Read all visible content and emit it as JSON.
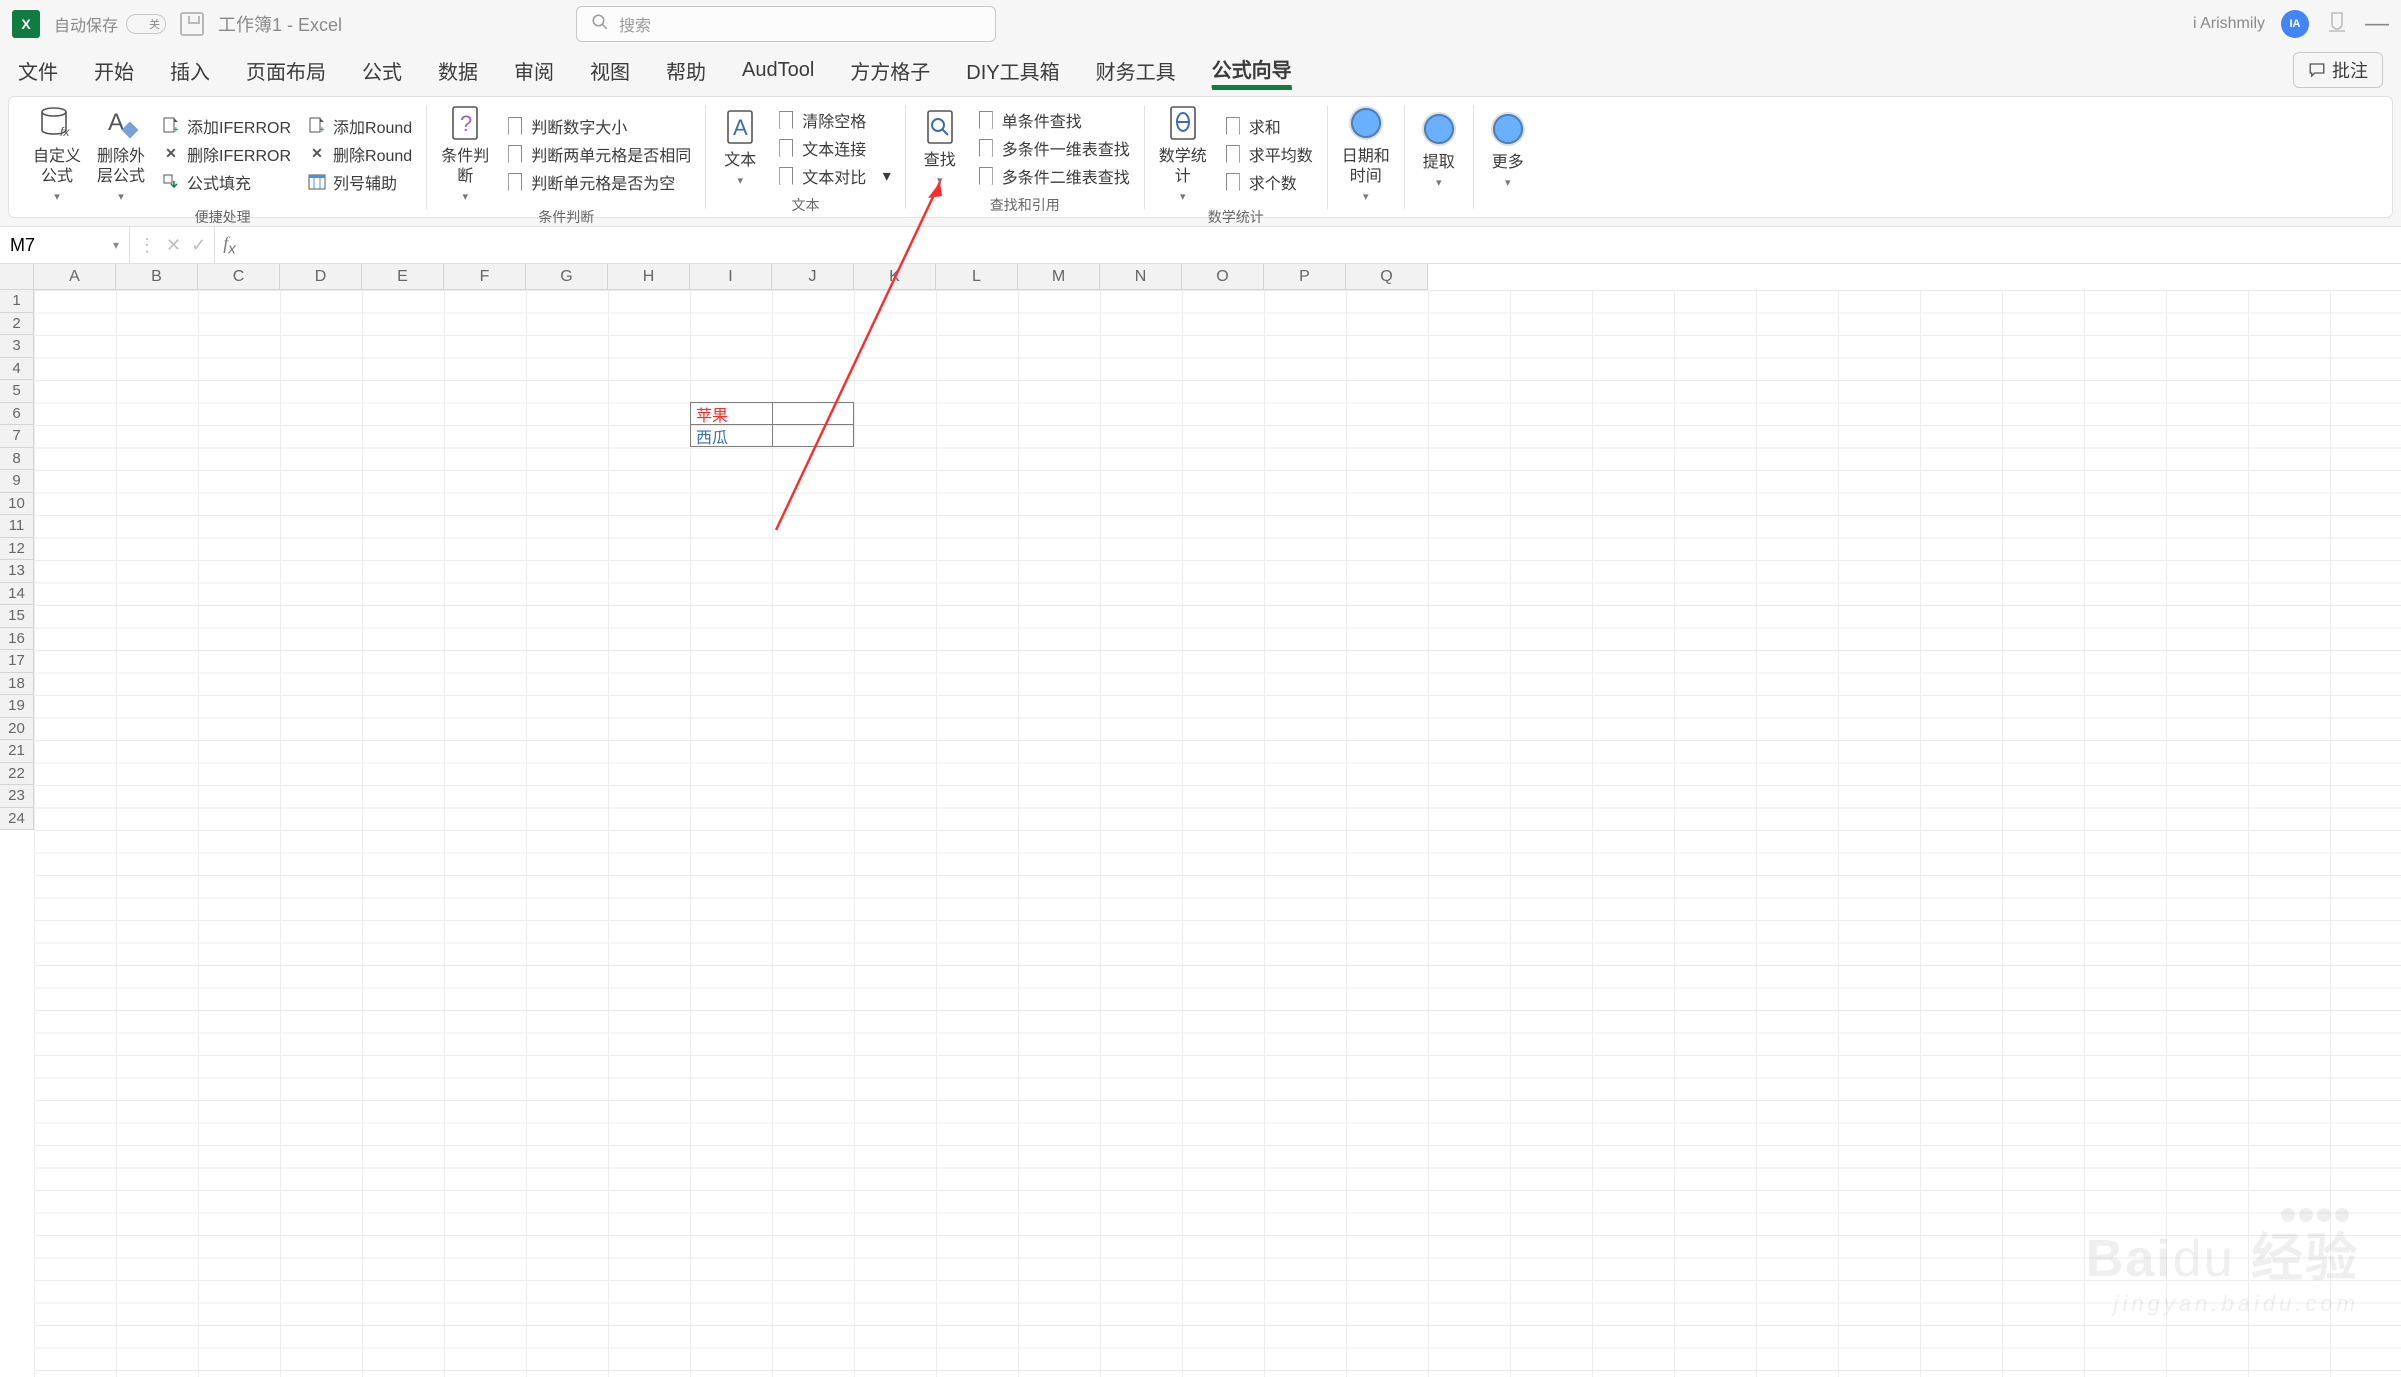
{
  "titleBar": {
    "appIconText": "X",
    "autosave": "自动保存",
    "autosaveState": "关",
    "docTitle": "工作簿1  -  Excel",
    "searchPlaceholder": "搜索",
    "user": "i Arishmily",
    "avatarInitials": "IA"
  },
  "tabs": {
    "items": [
      "文件",
      "开始",
      "插入",
      "页面布局",
      "公式",
      "数据",
      "审阅",
      "视图",
      "帮助",
      "AudTool",
      "方方格子",
      "DIY工具箱",
      "财务工具",
      "公式向导"
    ],
    "activeIndex": 13,
    "commentBtn": "批注"
  },
  "ribbon": {
    "group1": {
      "customFormulaBtn": "自定义\n公式",
      "delOuterBtn": "删除外\n层公式",
      "addIferror": "添加IFERROR",
      "delIferror": "删除IFERROR",
      "fillFormula": "公式填充",
      "addRound": "添加Round",
      "delRound": "删除Round",
      "colAssist": "列号辅助",
      "label": "便捷处理"
    },
    "group2": {
      "condBtn": "条件判\n断",
      "checkNumSize": "判断数字大小",
      "checkTwoCellEq": "判断两单元格是否相同",
      "checkCellEmpty": "判断单元格是否为空",
      "label": "条件判断"
    },
    "group3": {
      "textBtn": "文本",
      "clearSpace": "清除空格",
      "textConcat": "文本连接",
      "textCompare": "文本对比",
      "label": "文本"
    },
    "group4": {
      "findBtn": "查找",
      "singleCond": "单条件查找",
      "multi1d": "多条件一维表查找",
      "multi2d": "多条件二维表查找",
      "label": "查找和引用"
    },
    "group5": {
      "statBtn": "数学统\n计",
      "sum": "求和",
      "avg": "求平均数",
      "count": "求个数",
      "label": "数学统计"
    },
    "group6": {
      "dateBtn": "日期和\n时间"
    },
    "group7": {
      "extractBtn": "提取"
    },
    "group8": {
      "moreBtn": "更多"
    }
  },
  "formulaBar": {
    "nameBox": "M7"
  },
  "grid": {
    "columns": [
      "A",
      "B",
      "C",
      "D",
      "E",
      "F",
      "G",
      "H",
      "I",
      "J",
      "K",
      "L",
      "M",
      "N",
      "O",
      "P",
      "Q"
    ],
    "rows": [
      "1",
      "2",
      "3",
      "4",
      "5",
      "6",
      "7",
      "8",
      "9",
      "10",
      "11",
      "12",
      "13",
      "14",
      "15",
      "16",
      "17",
      "18",
      "19",
      "20",
      "21",
      "22",
      "23",
      "24"
    ],
    "cells": {
      "I6": {
        "text": "苹果",
        "color": "#ff2a2a"
      },
      "I7": {
        "text": "西瓜",
        "color": "#3a6db0"
      }
    }
  },
  "watermark": {
    "line1a": "Bai",
    "line1b": "du",
    "line1c": "经验",
    "line2": "jingyan.baidu.com"
  }
}
